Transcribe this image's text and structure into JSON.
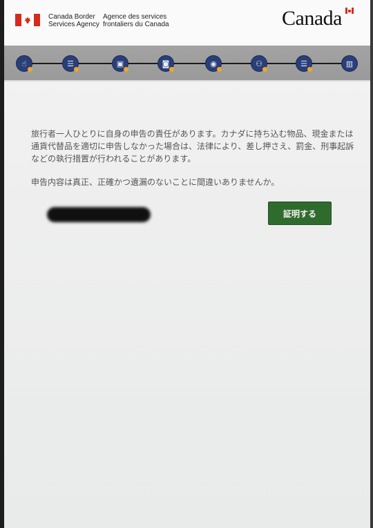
{
  "header": {
    "agency_en_line1": "Canada Border",
    "agency_en_line2": "Services Agency",
    "agency_fr_line1": "Agence des services",
    "agency_fr_line2": "frontaliers du Canada",
    "wordmark": "Canada"
  },
  "progress": {
    "steps": [
      {
        "icon": "hand-pointer-icon",
        "glyph": "☝"
      },
      {
        "icon": "list-icon",
        "glyph": "☰"
      },
      {
        "icon": "passport-icon",
        "glyph": "▣"
      },
      {
        "icon": "camera-icon",
        "glyph": "◙"
      },
      {
        "icon": "fingerprint-icon",
        "glyph": "◉"
      },
      {
        "icon": "people-icon",
        "glyph": "⚇"
      },
      {
        "icon": "checklist-icon",
        "glyph": "☰"
      },
      {
        "icon": "building-icon",
        "glyph": "▥"
      }
    ]
  },
  "main": {
    "declaration_text": "旅行者一人ひとりに自身の申告の責任があります。カナダに持ち込む物品、現金または通貨代替品を適切に申告しなかった場合は、法律により、差し押さえ、罰金、刑事起訴などの執行措置が行われることがあります。",
    "question": "申告内容は真正、正確かつ遺漏のないことに間違いありませんか。",
    "certify_label": "証明する"
  },
  "colors": {
    "progress_bg": "#9e9e9e",
    "step_fill": "#2a3e78",
    "step_badge": "#f0a52a",
    "button_green": "#2f6b2d",
    "flag_red": "#d52b1e"
  }
}
